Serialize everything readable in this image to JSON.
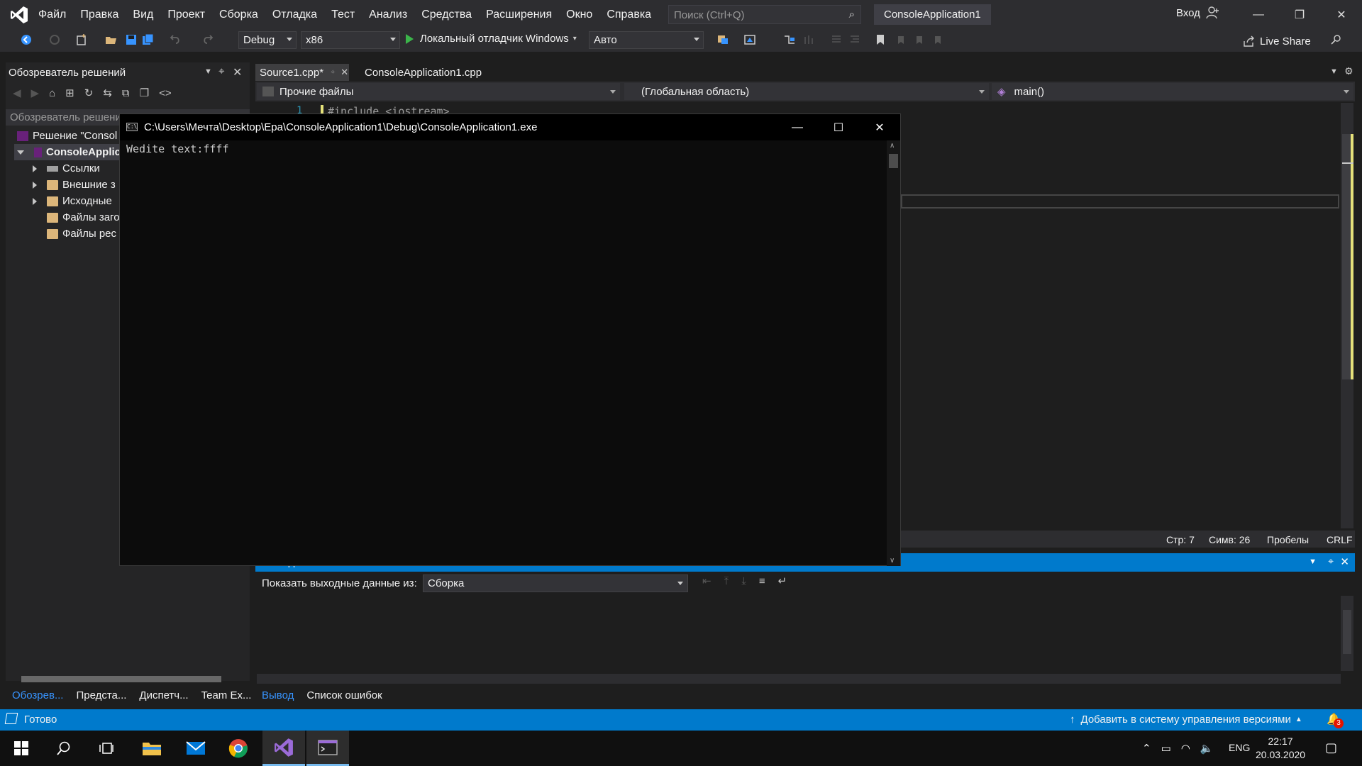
{
  "menubar": {
    "items": [
      "Файл",
      "Правка",
      "Вид",
      "Проект",
      "Сборка",
      "Отладка",
      "Тест",
      "Анализ",
      "Средства",
      "Расширения",
      "Окно",
      "Справка"
    ],
    "search_placeholder": "Поиск (Ctrl+Q)",
    "solution_name": "ConsoleApplication1",
    "sign_in": "Вход"
  },
  "toolbar": {
    "configuration": "Debug",
    "platform": "x86",
    "run_label": "Локальный отладчик Windows",
    "run_mode": "Авто",
    "live_share": "Live Share"
  },
  "solution_explorer": {
    "title": "Обозреватель решений",
    "search_placeholder": "Обозреватель решени",
    "tree": [
      {
        "label": "Решение \"Consol",
        "level": 0,
        "expander": "none"
      },
      {
        "label": "ConsoleApplic",
        "level": 1,
        "expander": "expanded",
        "bold": true
      },
      {
        "label": "Ссылки",
        "level": 2,
        "expander": "collapsed"
      },
      {
        "label": "Внешние з",
        "level": 2,
        "expander": "collapsed"
      },
      {
        "label": "Исходные",
        "level": 2,
        "expander": "collapsed"
      },
      {
        "label": "Файлы заго",
        "level": 2,
        "expander": "none"
      },
      {
        "label": "Файлы рес",
        "level": 2,
        "expander": "none"
      }
    ],
    "bottom_tabs": [
      "Обозрев...",
      "Предста...",
      "Диспетч...",
      "Team Ex..."
    ]
  },
  "editor": {
    "tabs": [
      {
        "label": "Source1.cpp*",
        "active": true
      },
      {
        "label": "ConsoleApplication1.cpp",
        "active": false
      }
    ],
    "nav_project": "Прочие файлы",
    "nav_scope": "(Глобальная область)",
    "nav_member": "main()",
    "line_number": "1",
    "code_line": "#include <iostream>",
    "status": {
      "line": "Стр: 7",
      "col": "Симв: 26",
      "whitespace": "Пробелы",
      "eol": "CRLF"
    }
  },
  "output": {
    "header_label": "Вывод",
    "show_from_label": "Показать выходные данные из:",
    "source": "Сборка",
    "bottom_tabs": [
      "Вывод",
      "Список ошибок"
    ]
  },
  "statusbar": {
    "text": "Готово",
    "vc_label": "Добавить в систему управления версиями",
    "notification_count": "3"
  },
  "console": {
    "title": "C:\\Users\\Мечта\\Desktop\\Ера\\ConsoleApplication1\\Debug\\ConsoleApplication1.exe",
    "output": "Wedite text:ffff",
    "icon_text": "C:\\"
  },
  "taskbar": {
    "lang": "ENG",
    "time": "22:17",
    "date": "20.03.2020"
  },
  "colors": {
    "accent": "#007acc",
    "background": "#1e1e1e",
    "panel": "#252526",
    "chrome": "#2d2d30"
  }
}
